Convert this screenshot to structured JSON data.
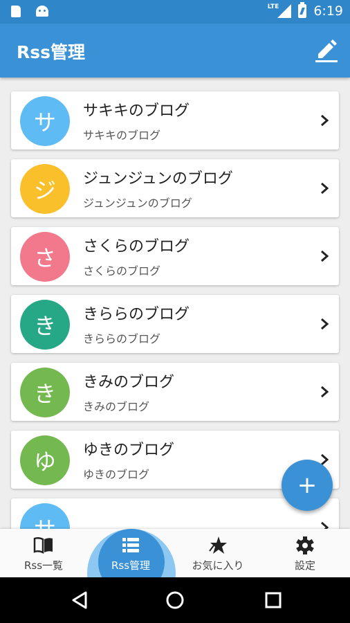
{
  "status_bar": {
    "network": "LTE",
    "time": "6:19"
  },
  "app_bar": {
    "title": "Rss管理"
  },
  "feeds": [
    {
      "initial": "サ",
      "title": "サキキのブログ",
      "subtitle": "サキキのブログ",
      "color": "#5ebbf4"
    },
    {
      "initial": "ジ",
      "title": "ジュンジュンのブログ",
      "subtitle": "ジュンジュンのブログ",
      "color": "#f9c02b"
    },
    {
      "initial": "さ",
      "title": "さくらのブログ",
      "subtitle": "さくらのブログ",
      "color": "#f2788c"
    },
    {
      "initial": "き",
      "title": "きららのブログ",
      "subtitle": "きららのブログ",
      "color": "#26a887"
    },
    {
      "initial": "き",
      "title": "きみのブログ",
      "subtitle": "きみのブログ",
      "color": "#74b94f"
    },
    {
      "initial": "ゆ",
      "title": "ゆきのブログ",
      "subtitle": "ゆきのブログ",
      "color": "#74b94f"
    },
    {
      "initial": "サ",
      "title": "",
      "subtitle": "",
      "color": "#5ebbf4"
    }
  ],
  "fab": {
    "label": "+",
    "icon": "plus-icon"
  },
  "bottom_nav": [
    {
      "label": "Rss一覧",
      "icon": "book-icon",
      "active": false
    },
    {
      "label": "Rss管理",
      "icon": "list-icon",
      "active": true
    },
    {
      "label": "お気に入り",
      "icon": "star-icon",
      "active": false
    },
    {
      "label": "設定",
      "icon": "gear-icon",
      "active": false
    }
  ],
  "colors": {
    "primary": "#3a91d6",
    "status_bar": "#2f86c9",
    "background": "#eeeeee"
  }
}
